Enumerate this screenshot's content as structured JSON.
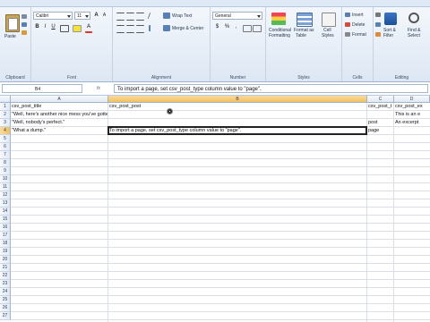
{
  "ribbon": {
    "groups": {
      "clipboard": "Clipboard",
      "font": "Font",
      "alignment": "Alignment",
      "number": "Number",
      "styles": "Styles",
      "cells": "Cells",
      "editing": "Editing"
    },
    "paste": "Paste",
    "font_name": "Calibri",
    "font_size": "11",
    "bold": "B",
    "italic": "I",
    "underline": "U",
    "grow": "A",
    "shrink": "A",
    "wrap_text": "Wrap Text",
    "merge_center": "Merge & Center",
    "number_format": "General",
    "currency": "$",
    "percent": "%",
    "comma": ",",
    "conditional": [
      "Conditional",
      "Formatting"
    ],
    "format_table": [
      "Format as",
      "Table"
    ],
    "cell_styles": [
      "Cell",
      "Styles"
    ],
    "insert": "Insert",
    "delete": "Delete",
    "format": "Format",
    "sort_filter": [
      "Sort &",
      "Filter"
    ],
    "find_select": [
      "Find &",
      "Select"
    ]
  },
  "formula_bar": {
    "name_box": "B4",
    "fx": "fx",
    "formula": "To import a page, set csv_post_type column value to \"page\"."
  },
  "columns": [
    "A",
    "B",
    "C",
    "D"
  ],
  "rows": [
    "1",
    "2",
    "3",
    "4",
    "5",
    "6",
    "7",
    "8",
    "9",
    "10",
    "11",
    "12",
    "13",
    "14",
    "15",
    "16",
    "17",
    "18",
    "19",
    "20",
    "21",
    "22",
    "23",
    "24",
    "25",
    "26",
    "27"
  ],
  "cells": {
    "A1": "csv_post_title",
    "B1": "csv_post_post",
    "C1": "csv_post_t",
    "D1": "csv_post_ex",
    "A2": "\"Well, here's another nice mess you've gotten me into!\"",
    "D2": "This is an e",
    "A3": "\"Well, nobody's perfect.\"",
    "C3": "post",
    "D3": "An excerpt",
    "A4": "\"What a dump.\"",
    "B4": "To import a page, set csv_post_type column value to \"page\".",
    "C4": "page"
  },
  "colors": {
    "ribbon_bg": "#dde7f3",
    "header_selected": "#f1c15f",
    "grid_line": "#dadfe6"
  }
}
